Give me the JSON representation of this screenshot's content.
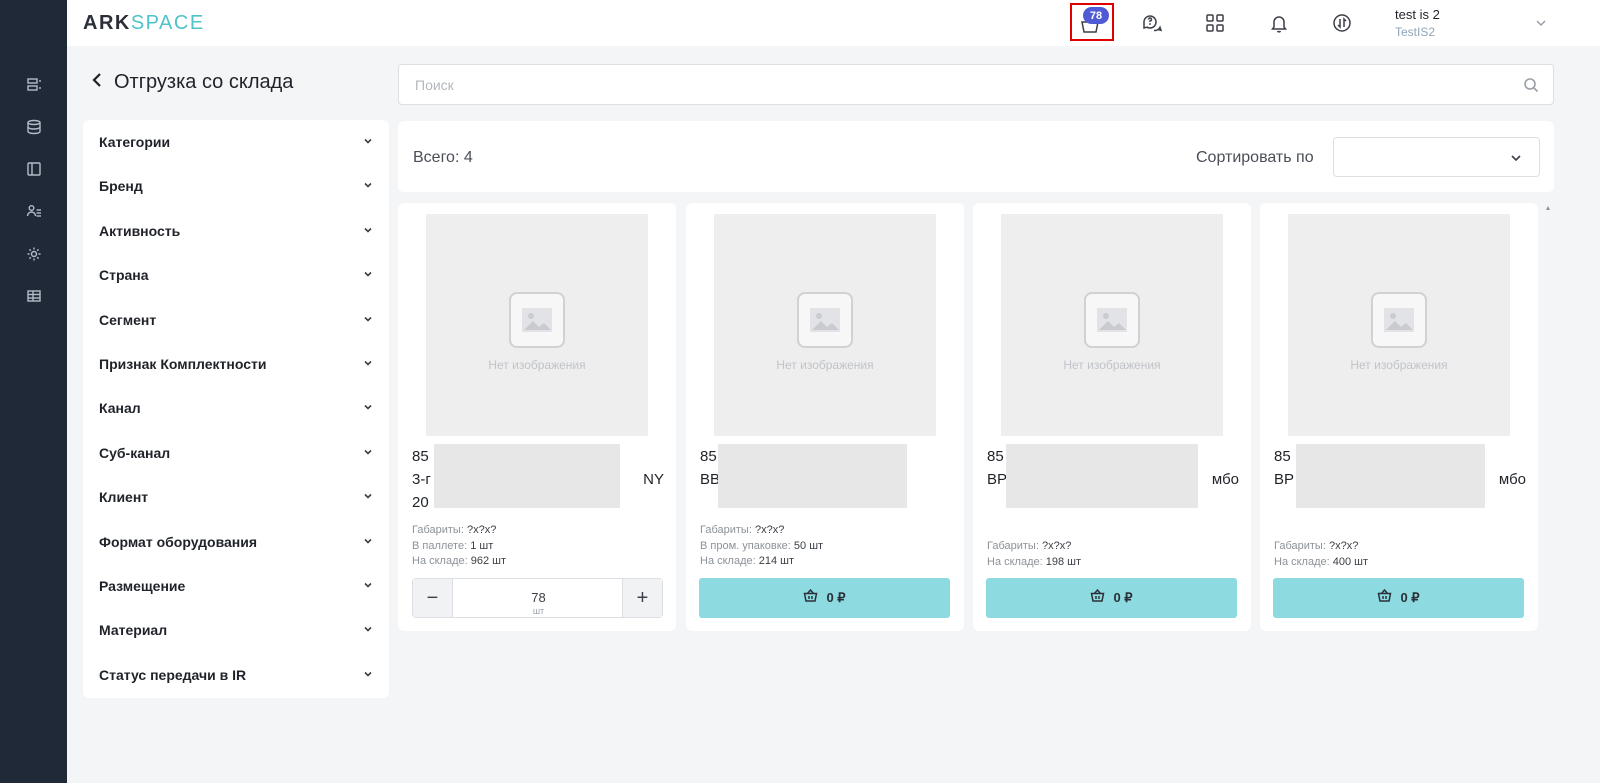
{
  "app": {
    "logo_main": "ARK",
    "logo_accent": "SPACE"
  },
  "header": {
    "cart_count": "78",
    "user_name": "test is 2",
    "user_company": "TestIS2"
  },
  "page": {
    "title": "Отгрузка со склада"
  },
  "search": {
    "placeholder": "Поиск",
    "value": ""
  },
  "filters": [
    "Категории",
    "Бренд",
    "Активность",
    "Страна",
    "Сегмент",
    "Признак Комплектности",
    "Канал",
    "Суб-канал",
    "Клиент",
    "Формат оборудования",
    "Размещение",
    "Материал",
    "Статус передачи в IR"
  ],
  "results": {
    "total": "Всего: 4",
    "sort_label": "Сортировать по",
    "sort_value": ""
  },
  "products": [
    {
      "no_image": "Нет изображения",
      "title_lines": [
        [
          "85",
          ""
        ],
        [
          "3-г",
          "NY"
        ],
        [
          "20",
          ""
        ]
      ],
      "meta": [
        [
          "Габариты: ",
          "?x?x?"
        ],
        [
          "В паллете: ",
          "1 шт"
        ],
        [
          "На складе: ",
          "962 шт"
        ]
      ],
      "in_cart": true,
      "qty": "78",
      "unit": "шт"
    },
    {
      "no_image": "Нет изображения",
      "title_lines": [
        [
          "85",
          ""
        ],
        [
          "BB",
          ""
        ]
      ],
      "meta": [
        [
          "Габариты: ",
          "?x?x?"
        ],
        [
          "В пром. упаковке: ",
          "50 шт"
        ],
        [
          "На складе: ",
          "214 шт"
        ]
      ],
      "in_cart": false,
      "price": "0 ₽"
    },
    {
      "no_image": "Нет изображения",
      "title_lines": [
        [
          "85",
          ""
        ],
        [
          "BP",
          "мбо"
        ]
      ],
      "meta": [
        [
          "Габариты: ",
          "?x?x?"
        ],
        [
          "На складе: ",
          "198 шт"
        ]
      ],
      "in_cart": false,
      "price": "0 ₽"
    },
    {
      "no_image": "Нет изображения",
      "title_lines": [
        [
          "85",
          ""
        ],
        [
          "BP",
          "мбо"
        ]
      ],
      "meta": [
        [
          "Габариты: ",
          "?x?x?"
        ],
        [
          "На складе: ",
          "400 шт"
        ]
      ],
      "in_cart": false,
      "price": "0 ₽"
    }
  ]
}
